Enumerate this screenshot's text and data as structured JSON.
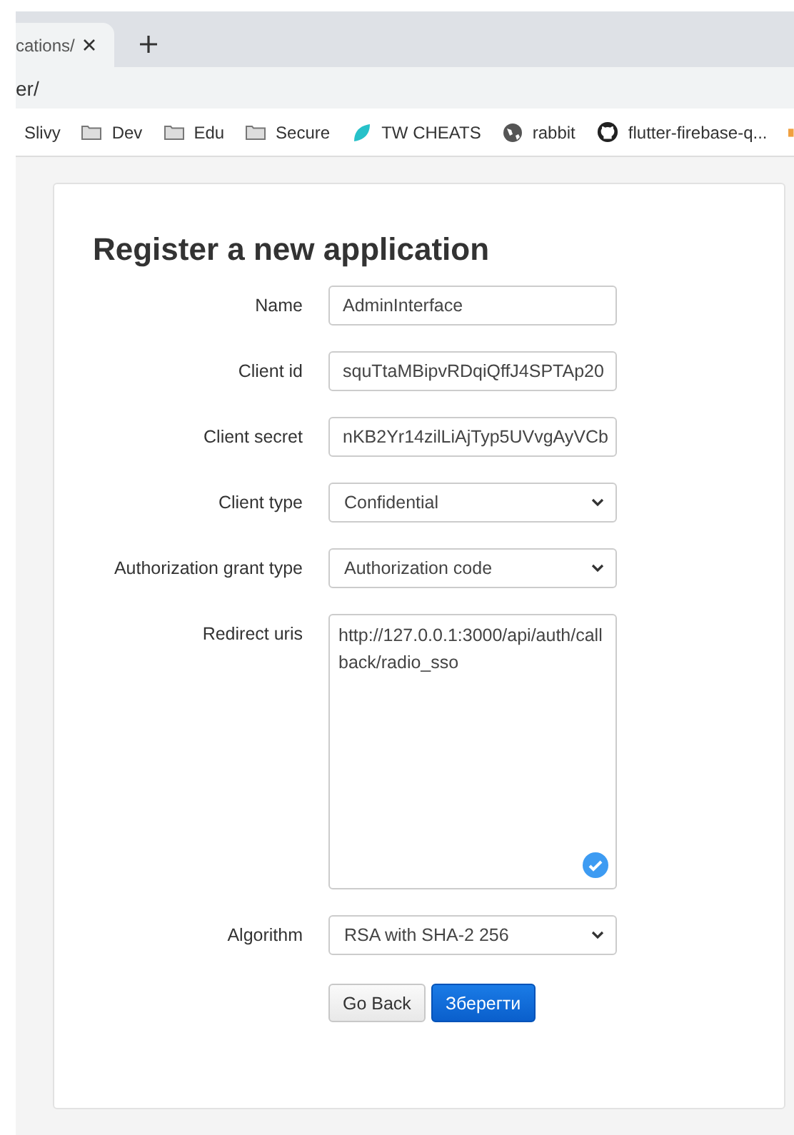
{
  "browser": {
    "tab": {
      "title": "cations/",
      "selected": true
    },
    "address": "er/",
    "bookmarks": [
      {
        "label": "Slivy",
        "kind": "plain"
      },
      {
        "label": "Dev",
        "kind": "folder"
      },
      {
        "label": "Edu",
        "kind": "folder"
      },
      {
        "label": "Secure",
        "kind": "folder"
      },
      {
        "label": "TW CHEATS",
        "kind": "leaf"
      },
      {
        "label": "rabbit",
        "kind": "globe"
      },
      {
        "label": "flutter-firebase-q...",
        "kind": "cat"
      }
    ]
  },
  "form": {
    "title": "Register a new application",
    "fields": [
      {
        "label": "Name",
        "kind": "input",
        "value": "AdminInterface"
      },
      {
        "label": "Client id",
        "kind": "input",
        "value": "squTtaMBipvRDqiQffJ4SPTAp20"
      },
      {
        "label": "Client secret",
        "kind": "input",
        "value": "nKB2Yr14zilLiAjTyp5UVvgAyVCb"
      },
      {
        "label": "Client type",
        "kind": "select",
        "value": "Confidential"
      },
      {
        "label": "Authorization grant type",
        "kind": "select",
        "value": "Authorization code"
      },
      {
        "label": "Redirect uris",
        "kind": "textarea",
        "value": "http://127.0.0.1:3000/api/auth/callback/radio_sso"
      },
      {
        "label": "Algorithm",
        "kind": "select",
        "value": "RSA with SHA-2 256"
      }
    ],
    "buttons": [
      {
        "label": "Go Back",
        "kind": "secondary"
      },
      {
        "label": "Зберегти",
        "kind": "primary"
      }
    ]
  }
}
